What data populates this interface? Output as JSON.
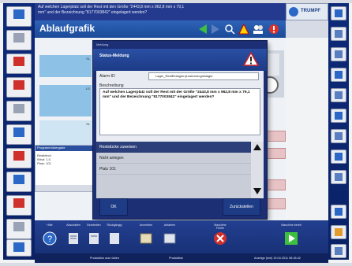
{
  "header": {
    "message_lines": [
      "Auf welchen Lagerplatz soll der Rest mit den Größe \"2443,8 mm x 962,8 mm x 79,1",
      "mm\" und der Bezeichnung \"8177003842\" eingelagert werden?"
    ],
    "page_title": "Ablaufgrafik",
    "logo_text": "TRUMPF"
  },
  "dialog": {
    "header_text": "Meldung",
    "title": "Status-Meldung",
    "alarm_label": "Alarm-ID",
    "alarm_value": "Lager_RestEinlagern(Lasterzeugnislager",
    "description_label": "Beschreibung",
    "description": "Auf welchen Lagerplatz soll der Rest mit der Größe \"2443,8 mm x 962,8 mm x 79,1 mm\" und der Bezeichnung \"8177003842\" eingelagert werden?",
    "action_header": "Reststücke zuweisen",
    "actions": [
      "Nicht anlegen",
      "Platz 101"
    ],
    "ok_label": "OK",
    "reset_label": "Zurückstellen"
  },
  "workspace": {
    "panel_title": "Programmübergabe",
    "panel_lines": [
      "Restblech",
      "Wind: 1.0",
      "Platz: 101"
    ],
    "blue_tags": [
      "SL",
      "LG",
      "SL"
    ]
  },
  "bottom_bar": {
    "buttons": [
      "Hilfe",
      "Abschalten",
      "Bearbeiten",
      "Rückgängig",
      "Anmelden",
      "Anfahren",
      "Maschine Fehler",
      "Maschine bereit"
    ]
  },
  "status_bar": {
    "left": "Produktion aus rüsten",
    "middle": "Produktion",
    "right": "Anzeige [mm]   19.04.2011 08:18:42"
  },
  "colors": {
    "frame_blue": "#0d2a7a",
    "accent_blue": "#2b67c6",
    "dialog_blue": "#1c2f75",
    "warning_red": "#d0302c"
  }
}
